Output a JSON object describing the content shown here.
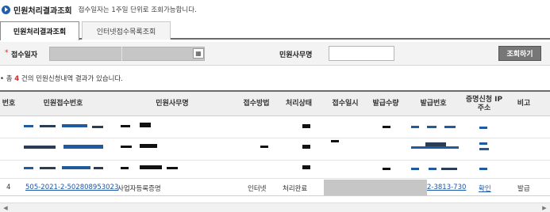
{
  "header": {
    "title": "민원처리결과조회",
    "description": "접수일자는 1주일 단위로 조회가능합니다."
  },
  "tabs": [
    {
      "label": "민원처리결과조회",
      "active": true
    },
    {
      "label": "인터넷접수목록조회",
      "active": false
    }
  ],
  "search": {
    "required_mark": "*",
    "date_label": "접수일자",
    "name_label": "민원사무명",
    "name_value": "",
    "submit_label": "조회하기"
  },
  "summary": {
    "prefix": "• 총",
    "count": "4",
    "suffix": "건의 민원신청내역 결과가 있습니다."
  },
  "table": {
    "columns": [
      "번호",
      "민원접수번호",
      "민원사무명",
      "접수방법",
      "처리상태",
      "접수일시",
      "발급수량",
      "발급번호",
      "증명신청 IP주소",
      "비고"
    ],
    "visible_row": {
      "no": "4",
      "receipt_no": "505-2021-2-502808953023",
      "service_name": "사업자등록증명",
      "method": "인터넷",
      "status": "처리완료",
      "issue_no": "2-3813-730",
      "ip_action": "확인",
      "note": "발급"
    }
  },
  "colors": {
    "accent_blue": "#1f5fae",
    "link_blue": "#1a56a8",
    "required_red": "#d8232a",
    "button_gray": "#777777"
  }
}
